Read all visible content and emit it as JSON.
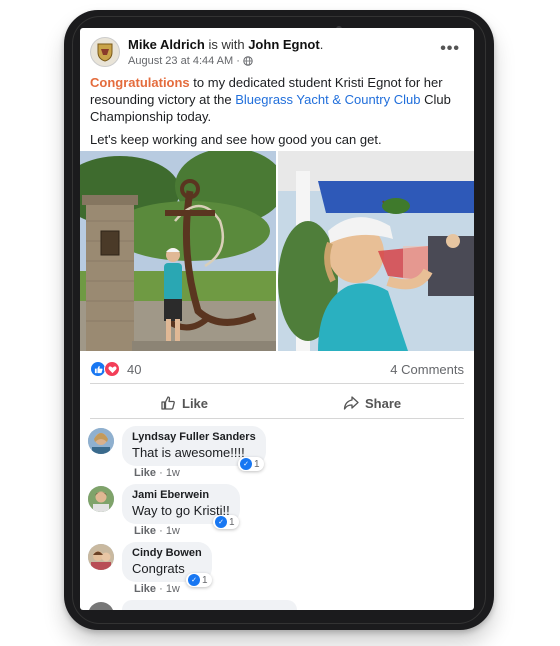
{
  "post": {
    "author": "Mike Aldrich",
    "with_text": "is with",
    "tagged": "John Egnot",
    "period": ".",
    "timestamp": "August 23 at 4:44 AM",
    "meta_sep": "·",
    "more": "•••",
    "text_congrats": "Congratulations",
    "text_part1": " to my dedicated student Kristi Egnot for her resounding victory at the ",
    "text_club": "Bluegrass Yacht & Country Club",
    "text_part2": " Club Championship today.",
    "text_second": "Let's keep working and see how good you can get."
  },
  "stats": {
    "reaction_count": "40",
    "comments_label": "4 Comments"
  },
  "actions": {
    "like_label": "Like",
    "share_label": "Share"
  },
  "comments": [
    {
      "name": "Lyndsay Fuller Sanders",
      "text": "That is awesome!!!!",
      "like": "Like",
      "sep": "·",
      "time": "1w",
      "reacts": "1"
    },
    {
      "name": "Jami Eberwein",
      "text": "Way to go Kristi!!",
      "like": "Like",
      "sep": "·",
      "time": "1w",
      "reacts": "1"
    },
    {
      "name": "Cindy Bowen",
      "text": "Congrats",
      "like": "Like",
      "sep": "·",
      "time": "1w",
      "reacts": "1"
    }
  ],
  "colors": {
    "brand_blue": "#1877f2",
    "love_red": "#f33e58",
    "accent_orange": "#e46c3d",
    "link_blue": "#216fdb"
  },
  "icons": [
    "globe-icon",
    "more-options-icon",
    "like-reaction-icon",
    "love-reaction-icon",
    "thumbs-up-icon",
    "share-arrow-icon"
  ]
}
